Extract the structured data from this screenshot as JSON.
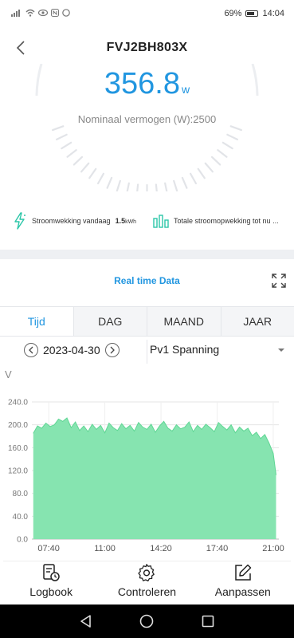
{
  "status_bar": {
    "battery_percent": "69%",
    "time": "14:04"
  },
  "header": {
    "title": "FVJ2BH803X"
  },
  "gauge": {
    "power_value": "356.8",
    "power_unit": "w",
    "nominal_label": "Nominaal vermogen (W):2500"
  },
  "stats": {
    "today_label": "Stroomwekking vandaag",
    "today_value": "1.5",
    "today_unit": "kWh",
    "total_label": "Totale stroomopwekking tot nu ..."
  },
  "realtime_label": "Real time Data",
  "tabs": [
    {
      "label": "Tijd",
      "active": true
    },
    {
      "label": "DAG",
      "active": false
    },
    {
      "label": "MAAND",
      "active": false
    },
    {
      "label": "JAAR",
      "active": false
    }
  ],
  "date": "2023-04-30",
  "select_value": "Pv1 Spanning",
  "y_unit": "V",
  "colors": {
    "accent": "#2196e0",
    "chart_fill": "#86e4b0",
    "chart_line": "#5fd694",
    "gauge_tick": "#e2e4e8"
  },
  "chart_data": {
    "type": "area",
    "ylabel": "V",
    "ylim": [
      0,
      240
    ],
    "yticks": [
      "0.0",
      "40.0",
      "80.0",
      "120.0",
      "160.0",
      "200.0",
      "240.0"
    ],
    "xticks": [
      "07:40",
      "11:00",
      "14:20",
      "17:40",
      "21:00"
    ],
    "xlim": [
      "06:40",
      "21:20"
    ],
    "series": [
      {
        "x": [
          "06:45",
          "07:00",
          "07:15",
          "07:30",
          "07:45",
          "08:00",
          "08:15",
          "08:30",
          "08:45",
          "09:00",
          "09:15",
          "09:30",
          "09:45",
          "10:00",
          "10:15",
          "10:30",
          "10:45",
          "11:00",
          "11:15",
          "11:30",
          "11:45",
          "12:00",
          "12:15",
          "12:30",
          "12:45",
          "13:00",
          "13:15",
          "13:30",
          "13:45",
          "14:00",
          "14:15",
          "14:30",
          "14:45",
          "15:00",
          "15:15",
          "15:30",
          "15:45",
          "16:00",
          "16:15",
          "16:30",
          "16:45",
          "17:00",
          "17:15",
          "17:30",
          "17:45",
          "18:00",
          "18:15",
          "18:30",
          "18:45",
          "19:00",
          "19:15",
          "19:30",
          "19:45",
          "20:00",
          "20:15",
          "20:30",
          "20:45",
          "21:00",
          "21:10"
        ],
        "values": [
          185,
          198,
          194,
          203,
          197,
          200,
          210,
          206,
          212,
          195,
          205,
          190,
          198,
          188,
          201,
          192,
          199,
          186,
          203,
          195,
          190,
          202,
          193,
          199,
          189,
          204,
          196,
          192,
          201,
          187,
          198,
          206,
          194,
          189,
          200,
          193,
          196,
          205,
          188,
          199,
          192,
          201,
          195,
          188,
          204,
          197,
          191,
          200,
          186,
          196,
          189,
          194,
          181,
          187,
          176,
          183,
          168,
          150,
          112
        ]
      }
    ]
  },
  "bottom_nav": [
    {
      "label": "Logbook",
      "icon": "logbook-icon"
    },
    {
      "label": "Controleren",
      "icon": "gear-icon"
    },
    {
      "label": "Aanpassen",
      "icon": "edit-icon"
    }
  ]
}
